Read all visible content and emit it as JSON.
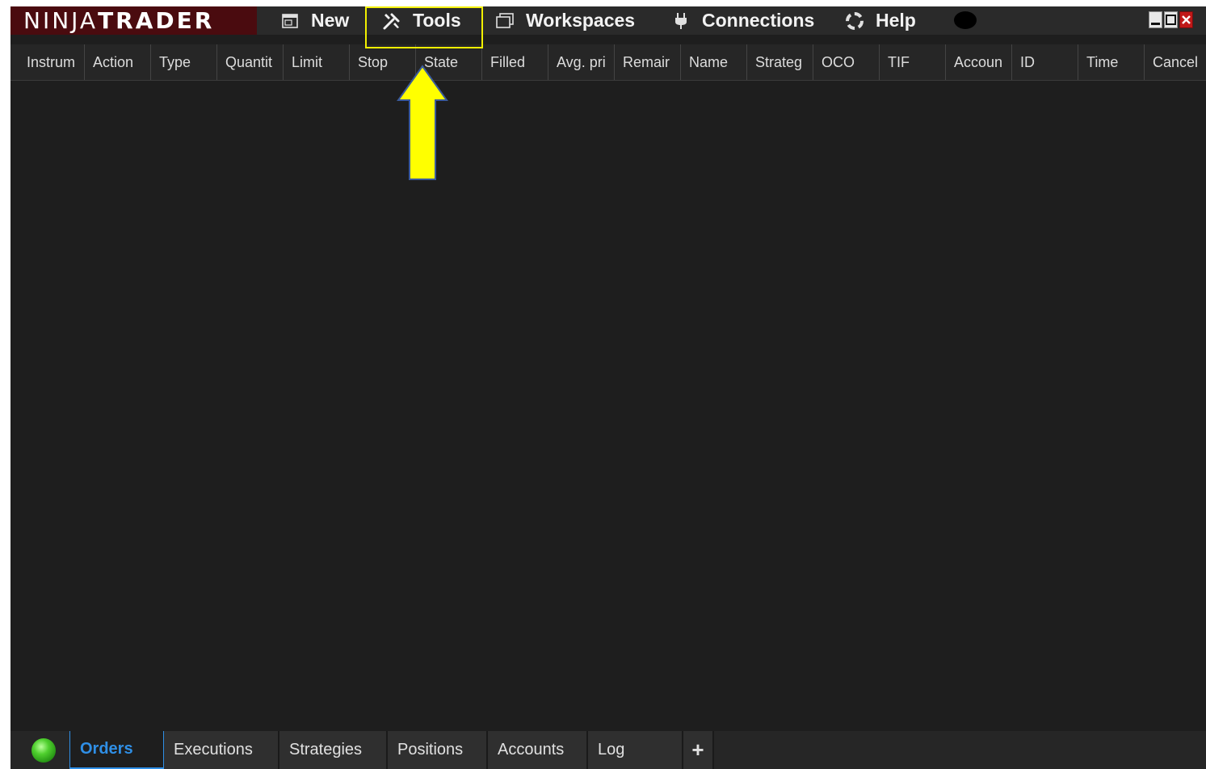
{
  "app": {
    "logo_left": "NINJA",
    "logo_right": "TRADER"
  },
  "menu": [
    {
      "label": "New",
      "icon": "new-window-icon"
    },
    {
      "label": "Tools",
      "icon": "tools-icon"
    },
    {
      "label": "Workspaces",
      "icon": "workspaces-icon"
    },
    {
      "label": "Connections",
      "icon": "plug-icon"
    },
    {
      "label": "Help",
      "icon": "help-icon"
    }
  ],
  "columns": [
    "Instrum",
    "Action",
    "Type",
    "Quantit",
    "Limit",
    "Stop",
    "State",
    "Filled",
    "Avg. pri",
    "Remair",
    "Name",
    "Strateg",
    "OCO",
    "TIF",
    "Accoun",
    "ID",
    "Time",
    "Cancel"
  ],
  "tabs": [
    {
      "label": "Orders",
      "active": true
    },
    {
      "label": "Executions",
      "active": false
    },
    {
      "label": "Strategies",
      "active": false
    },
    {
      "label": "Positions",
      "active": false
    },
    {
      "label": "Accounts",
      "active": false
    },
    {
      "label": "Log",
      "active": false
    },
    {
      "label": "+",
      "active": false
    }
  ],
  "colors": {
    "background": "#1e1e1e",
    "logo_background": "#4a0b0f",
    "highlight": "#f2f000",
    "arrow": "#ffff00",
    "active_tab": "#2f8fe6",
    "status_connected": "#3cc21f"
  }
}
